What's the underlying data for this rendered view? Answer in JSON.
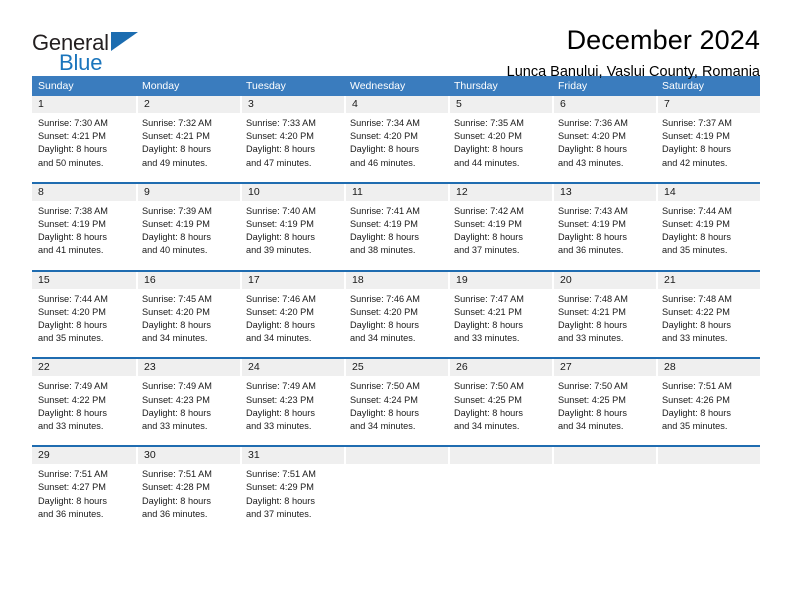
{
  "brand": {
    "name_top": "General",
    "name_bottom": "Blue",
    "triangle_color": "#1b6cb0",
    "blue_text_color": "#1b75bc"
  },
  "header": {
    "month_title": "December 2024",
    "location": "Lunca Banului, Vaslui County, Romania"
  },
  "colors": {
    "header_row_bg": "#3a7cbe",
    "header_row_text": "#ffffff",
    "day_number_bg": "#efefef",
    "week_divider": "#1f6cb0",
    "page_bg": "#ffffff"
  },
  "calendar": {
    "weekdays": [
      "Sunday",
      "Monday",
      "Tuesday",
      "Wednesday",
      "Thursday",
      "Friday",
      "Saturday"
    ],
    "weeks": [
      [
        {
          "day": "1",
          "sunrise": "Sunrise: 7:30 AM",
          "sunset": "Sunset: 4:21 PM",
          "daylight_line1": "Daylight: 8 hours",
          "daylight_line2": "and 50 minutes."
        },
        {
          "day": "2",
          "sunrise": "Sunrise: 7:32 AM",
          "sunset": "Sunset: 4:21 PM",
          "daylight_line1": "Daylight: 8 hours",
          "daylight_line2": "and 49 minutes."
        },
        {
          "day": "3",
          "sunrise": "Sunrise: 7:33 AM",
          "sunset": "Sunset: 4:20 PM",
          "daylight_line1": "Daylight: 8 hours",
          "daylight_line2": "and 47 minutes."
        },
        {
          "day": "4",
          "sunrise": "Sunrise: 7:34 AM",
          "sunset": "Sunset: 4:20 PM",
          "daylight_line1": "Daylight: 8 hours",
          "daylight_line2": "and 46 minutes."
        },
        {
          "day": "5",
          "sunrise": "Sunrise: 7:35 AM",
          "sunset": "Sunset: 4:20 PM",
          "daylight_line1": "Daylight: 8 hours",
          "daylight_line2": "and 44 minutes."
        },
        {
          "day": "6",
          "sunrise": "Sunrise: 7:36 AM",
          "sunset": "Sunset: 4:20 PM",
          "daylight_line1": "Daylight: 8 hours",
          "daylight_line2": "and 43 minutes."
        },
        {
          "day": "7",
          "sunrise": "Sunrise: 7:37 AM",
          "sunset": "Sunset: 4:19 PM",
          "daylight_line1": "Daylight: 8 hours",
          "daylight_line2": "and 42 minutes."
        }
      ],
      [
        {
          "day": "8",
          "sunrise": "Sunrise: 7:38 AM",
          "sunset": "Sunset: 4:19 PM",
          "daylight_line1": "Daylight: 8 hours",
          "daylight_line2": "and 41 minutes."
        },
        {
          "day": "9",
          "sunrise": "Sunrise: 7:39 AM",
          "sunset": "Sunset: 4:19 PM",
          "daylight_line1": "Daylight: 8 hours",
          "daylight_line2": "and 40 minutes."
        },
        {
          "day": "10",
          "sunrise": "Sunrise: 7:40 AM",
          "sunset": "Sunset: 4:19 PM",
          "daylight_line1": "Daylight: 8 hours",
          "daylight_line2": "and 39 minutes."
        },
        {
          "day": "11",
          "sunrise": "Sunrise: 7:41 AM",
          "sunset": "Sunset: 4:19 PM",
          "daylight_line1": "Daylight: 8 hours",
          "daylight_line2": "and 38 minutes."
        },
        {
          "day": "12",
          "sunrise": "Sunrise: 7:42 AM",
          "sunset": "Sunset: 4:19 PM",
          "daylight_line1": "Daylight: 8 hours",
          "daylight_line2": "and 37 minutes."
        },
        {
          "day": "13",
          "sunrise": "Sunrise: 7:43 AM",
          "sunset": "Sunset: 4:19 PM",
          "daylight_line1": "Daylight: 8 hours",
          "daylight_line2": "and 36 minutes."
        },
        {
          "day": "14",
          "sunrise": "Sunrise: 7:44 AM",
          "sunset": "Sunset: 4:19 PM",
          "daylight_line1": "Daylight: 8 hours",
          "daylight_line2": "and 35 minutes."
        }
      ],
      [
        {
          "day": "15",
          "sunrise": "Sunrise: 7:44 AM",
          "sunset": "Sunset: 4:20 PM",
          "daylight_line1": "Daylight: 8 hours",
          "daylight_line2": "and 35 minutes."
        },
        {
          "day": "16",
          "sunrise": "Sunrise: 7:45 AM",
          "sunset": "Sunset: 4:20 PM",
          "daylight_line1": "Daylight: 8 hours",
          "daylight_line2": "and 34 minutes."
        },
        {
          "day": "17",
          "sunrise": "Sunrise: 7:46 AM",
          "sunset": "Sunset: 4:20 PM",
          "daylight_line1": "Daylight: 8 hours",
          "daylight_line2": "and 34 minutes."
        },
        {
          "day": "18",
          "sunrise": "Sunrise: 7:46 AM",
          "sunset": "Sunset: 4:20 PM",
          "daylight_line1": "Daylight: 8 hours",
          "daylight_line2": "and 34 minutes."
        },
        {
          "day": "19",
          "sunrise": "Sunrise: 7:47 AM",
          "sunset": "Sunset: 4:21 PM",
          "daylight_line1": "Daylight: 8 hours",
          "daylight_line2": "and 33 minutes."
        },
        {
          "day": "20",
          "sunrise": "Sunrise: 7:48 AM",
          "sunset": "Sunset: 4:21 PM",
          "daylight_line1": "Daylight: 8 hours",
          "daylight_line2": "and 33 minutes."
        },
        {
          "day": "21",
          "sunrise": "Sunrise: 7:48 AM",
          "sunset": "Sunset: 4:22 PM",
          "daylight_line1": "Daylight: 8 hours",
          "daylight_line2": "and 33 minutes."
        }
      ],
      [
        {
          "day": "22",
          "sunrise": "Sunrise: 7:49 AM",
          "sunset": "Sunset: 4:22 PM",
          "daylight_line1": "Daylight: 8 hours",
          "daylight_line2": "and 33 minutes."
        },
        {
          "day": "23",
          "sunrise": "Sunrise: 7:49 AM",
          "sunset": "Sunset: 4:23 PM",
          "daylight_line1": "Daylight: 8 hours",
          "daylight_line2": "and 33 minutes."
        },
        {
          "day": "24",
          "sunrise": "Sunrise: 7:49 AM",
          "sunset": "Sunset: 4:23 PM",
          "daylight_line1": "Daylight: 8 hours",
          "daylight_line2": "and 33 minutes."
        },
        {
          "day": "25",
          "sunrise": "Sunrise: 7:50 AM",
          "sunset": "Sunset: 4:24 PM",
          "daylight_line1": "Daylight: 8 hours",
          "daylight_line2": "and 34 minutes."
        },
        {
          "day": "26",
          "sunrise": "Sunrise: 7:50 AM",
          "sunset": "Sunset: 4:25 PM",
          "daylight_line1": "Daylight: 8 hours",
          "daylight_line2": "and 34 minutes."
        },
        {
          "day": "27",
          "sunrise": "Sunrise: 7:50 AM",
          "sunset": "Sunset: 4:25 PM",
          "daylight_line1": "Daylight: 8 hours",
          "daylight_line2": "and 34 minutes."
        },
        {
          "day": "28",
          "sunrise": "Sunrise: 7:51 AM",
          "sunset": "Sunset: 4:26 PM",
          "daylight_line1": "Daylight: 8 hours",
          "daylight_line2": "and 35 minutes."
        }
      ],
      [
        {
          "day": "29",
          "sunrise": "Sunrise: 7:51 AM",
          "sunset": "Sunset: 4:27 PM",
          "daylight_line1": "Daylight: 8 hours",
          "daylight_line2": "and 36 minutes."
        },
        {
          "day": "30",
          "sunrise": "Sunrise: 7:51 AM",
          "sunset": "Sunset: 4:28 PM",
          "daylight_line1": "Daylight: 8 hours",
          "daylight_line2": "and 36 minutes."
        },
        {
          "day": "31",
          "sunrise": "Sunrise: 7:51 AM",
          "sunset": "Sunset: 4:29 PM",
          "daylight_line1": "Daylight: 8 hours",
          "daylight_line2": "and 37 minutes."
        },
        {
          "day": "",
          "sunrise": "",
          "sunset": "",
          "daylight_line1": "",
          "daylight_line2": ""
        },
        {
          "day": "",
          "sunrise": "",
          "sunset": "",
          "daylight_line1": "",
          "daylight_line2": ""
        },
        {
          "day": "",
          "sunrise": "",
          "sunset": "",
          "daylight_line1": "",
          "daylight_line2": ""
        },
        {
          "day": "",
          "sunrise": "",
          "sunset": "",
          "daylight_line1": "",
          "daylight_line2": ""
        }
      ]
    ]
  }
}
